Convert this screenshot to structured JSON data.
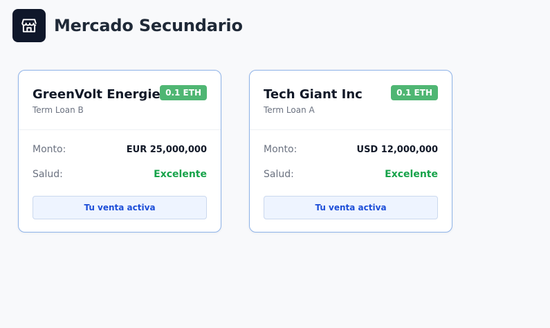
{
  "header": {
    "icon": "store-icon",
    "title": "Mercado Secundario"
  },
  "colors": {
    "accent": "#0f172a",
    "badge": "#4fb673",
    "health_good": "#16a34a",
    "button_text": "#1d4ed8"
  },
  "cards": [
    {
      "name": "GreenVolt Energies SA",
      "subtitle": "Term Loan B",
      "price": "0.1 ETH",
      "amount_label": "Monto:",
      "amount_value": "EUR 25,000,000",
      "health_label": "Salud:",
      "health_value": "Excelente",
      "button_label": "Tu venta activa"
    },
    {
      "name": "Tech Giant Inc",
      "subtitle": "Term Loan A",
      "price": "0.1 ETH",
      "amount_label": "Monto:",
      "amount_value": "USD 12,000,000",
      "health_label": "Salud:",
      "health_value": "Excelente",
      "button_label": "Tu venta activa"
    }
  ]
}
